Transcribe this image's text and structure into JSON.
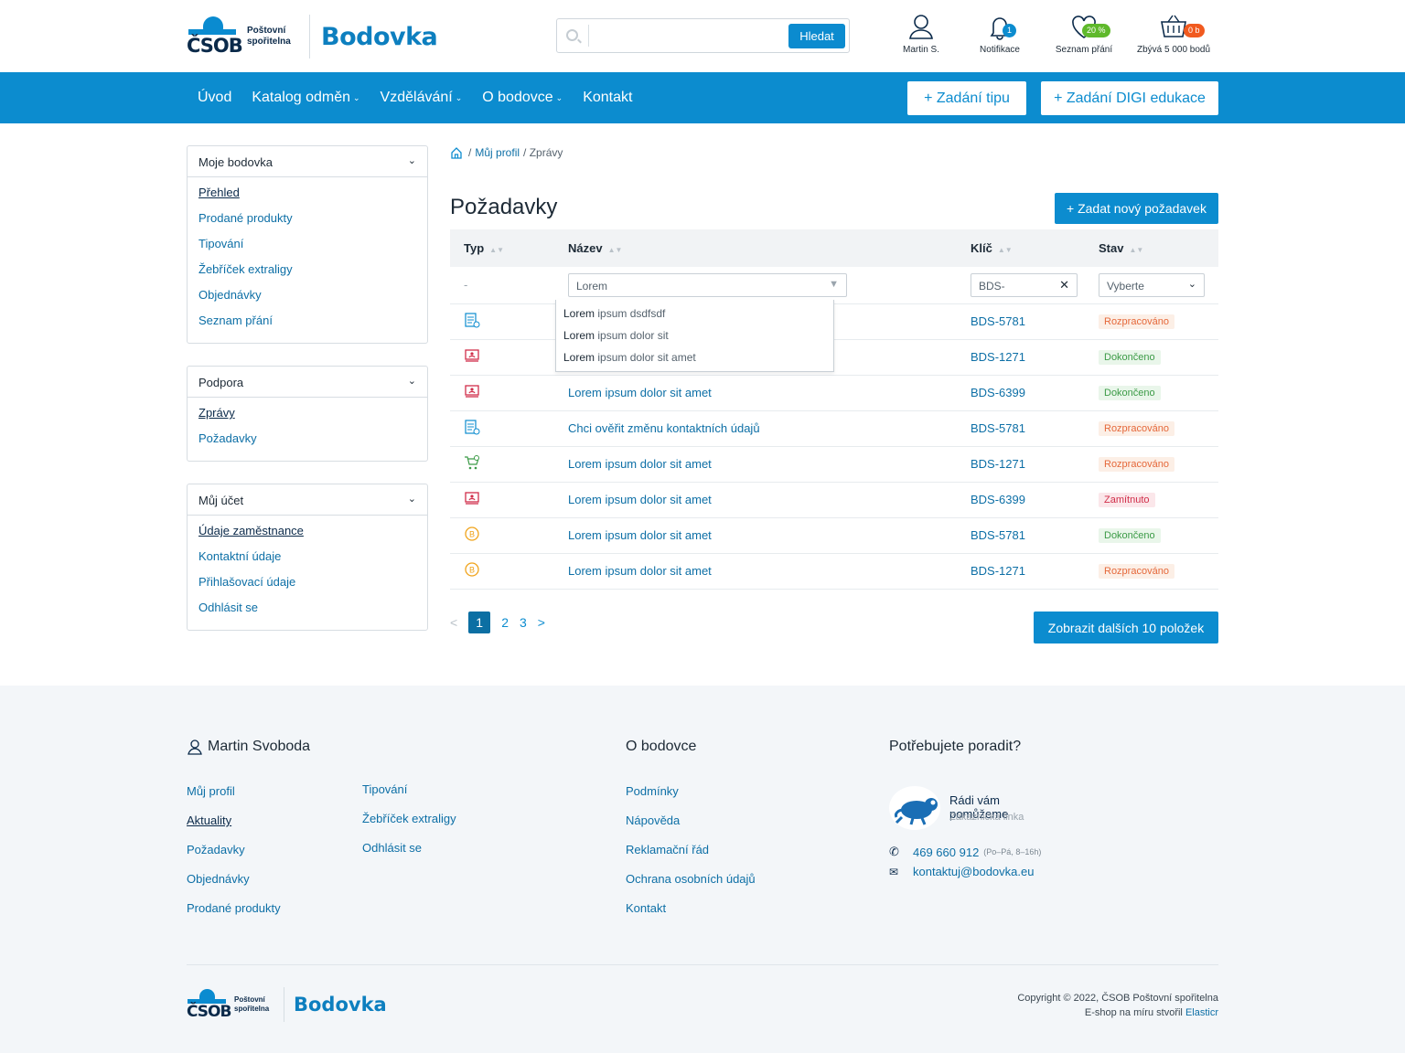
{
  "header": {
    "logo_text": "ČSOB",
    "logo_sub": "Poštovní spořitelna",
    "brand": "Bodovka",
    "search_button": "Hledat",
    "search_placeholder": "",
    "user": "Martin S.",
    "notifications": "Notifikace",
    "notifications_count": "1",
    "wishlist": "Seznam přání",
    "wishlist_badge": "20 %",
    "basket": "Zbývá 5 000 bodů",
    "basket_badge": "0 b"
  },
  "nav": {
    "items": [
      "Úvod",
      "Katalog odměn",
      "Vzdělávání",
      "O bodovce",
      "Kontakt"
    ],
    "btn_tip": "+ Zadání tipu",
    "btn_digi": "+ Zadání DIGI edukace"
  },
  "sidebar": [
    {
      "title": "Moje bodovka",
      "items": [
        "Přehled",
        "Prodané produkty",
        "Tipování",
        "Žebříček extraligy",
        "Objednávky",
        "Seznam přání"
      ]
    },
    {
      "title": "Podpora",
      "items": [
        "Zprávy",
        "Požadavky"
      ]
    },
    {
      "title": "Můj účet",
      "items": [
        "Údaje zaměstnance",
        "Kontaktní údaje",
        "Přihlašovací údaje",
        "Odhlásit se"
      ]
    }
  ],
  "breadcrumb": {
    "link": "Můj profil",
    "current": "Zprávy"
  },
  "page": {
    "title": "Požadavky",
    "add_button": "+ Zadat nový požadavek"
  },
  "table": {
    "headers": [
      "Typ",
      "Název",
      "Klíč",
      "Stav"
    ],
    "filter": {
      "type": "-",
      "name": "Lorem",
      "key": "BDS-",
      "state": "Vyberte"
    },
    "dropdown": [
      {
        "bold": "Lorem",
        "rest": " ipsum dsdfsdf"
      },
      {
        "bold": "Lorem",
        "rest": " ipsum dolor sit"
      },
      {
        "bold": "Lorem",
        "rest": " ipsum dolor sit amet"
      }
    ],
    "rows": [
      {
        "icon": "document-icon",
        "name": "",
        "key": "BDS-5781",
        "state": "Rozpracováno",
        "cls": "r"
      },
      {
        "icon": "presentation-icon",
        "name": "",
        "key": "BDS-1271",
        "state": "Dokončeno",
        "cls": "d"
      },
      {
        "icon": "presentation-icon",
        "name": "Lorem ipsum dolor sit amet",
        "key": "BDS-6399",
        "state": "Dokončeno",
        "cls": "d"
      },
      {
        "icon": "document-icon",
        "name": "Chci ověřit změnu kontaktních údajů",
        "key": "BDS-5781",
        "state": "Rozpracováno",
        "cls": "r"
      },
      {
        "icon": "cart-icon",
        "name": "Lorem ipsum dolor sit amet",
        "key": "BDS-1271",
        "state": "Rozpracováno",
        "cls": "r"
      },
      {
        "icon": "presentation-icon",
        "name": "Lorem ipsum dolor sit amet",
        "key": "BDS-6399",
        "state": "Zamítnuto",
        "cls": "z"
      },
      {
        "icon": "coin-icon",
        "name": "Lorem ipsum dolor sit amet",
        "key": "BDS-5781",
        "state": "Dokončeno",
        "cls": "d"
      },
      {
        "icon": "coin-icon",
        "name": "Lorem ipsum dolor sit amet",
        "key": "BDS-1271",
        "state": "Rozpracováno",
        "cls": "r"
      }
    ]
  },
  "pager": {
    "prev": "<",
    "pages": [
      "1",
      "2",
      "3"
    ],
    "next": ">",
    "more": "Zobrazit dalších 10 položek"
  },
  "footer": {
    "user_name": "Martin Svoboda",
    "col1": [
      "Můj profil",
      "Aktuality",
      "Požadavky",
      "Objednávky",
      "Prodané produkty"
    ],
    "col2": [
      "Tipování",
      "Žebříček extraligy",
      "Odhlásit se"
    ],
    "about_title": "O bodovce",
    "about": [
      "Podmínky",
      "Nápověda",
      "Reklamační řád",
      "Ochrana osobních údajů",
      "Kontakt"
    ],
    "help_title": "Potřebujete poradit?",
    "help_head": "Rádi vám pomůžeme",
    "help_sub": "Zákaznická linka",
    "phone": "469 660 912",
    "phone_hours": "(Po–Pá, 8–16h)",
    "email": "kontaktuj@bodovka.eu",
    "copyright": "Copyright © 2022, ČSOB Poštovní spořitelna",
    "made_by": "E-shop na míru stvořil",
    "made_by_link": "Elasticr"
  },
  "colors": {
    "primary": "#0c8ccf",
    "dark": "#0b2a4a",
    "orange": "#e5683a",
    "green": "#3c9b47",
    "red": "#d12e4a"
  }
}
